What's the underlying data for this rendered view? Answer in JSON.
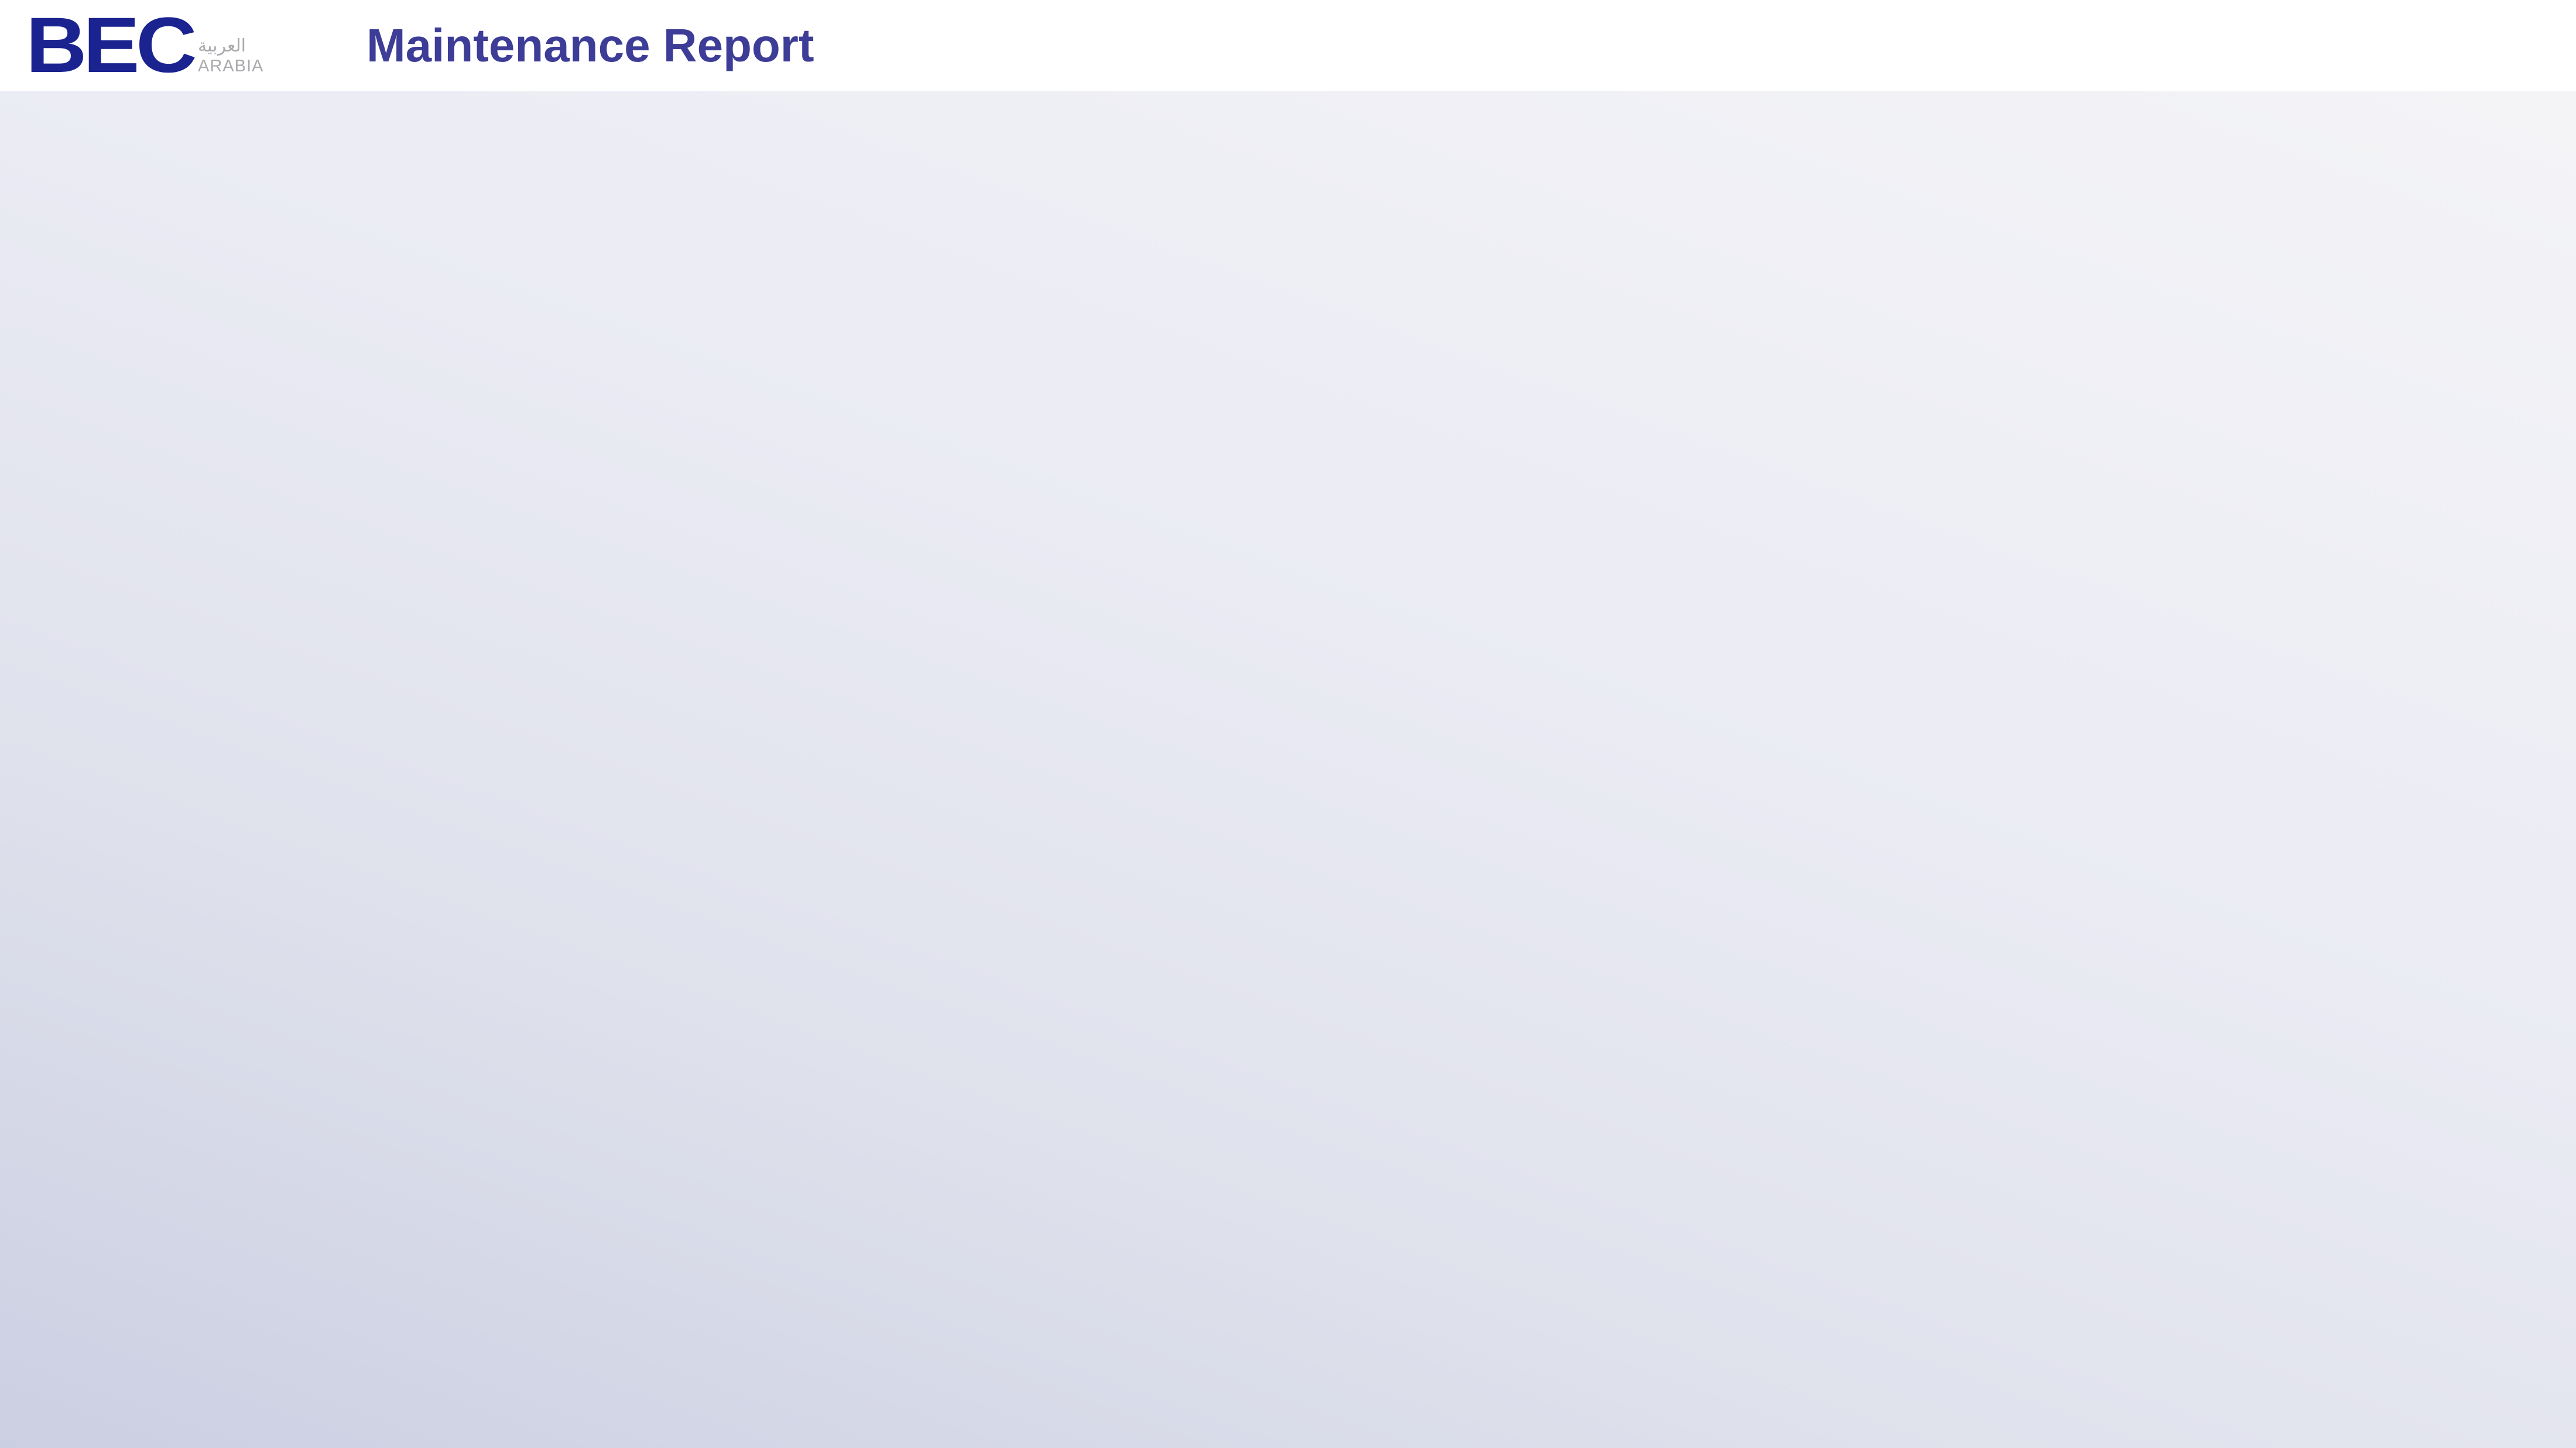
{
  "header": {
    "logo": {
      "mark": "BEC",
      "arabic_text": "العربية",
      "latin_text": "ARABIA"
    },
    "title": "Maintenance Report"
  },
  "colors": {
    "brand_navy": "#1a238f",
    "title_purple": "#3d3d97",
    "logo_gray": "#a9a9ae",
    "header_background": "#ffffff",
    "content_gradient_light": "#f4f4f7",
    "content_gradient_dark": "#cbcfe2"
  }
}
